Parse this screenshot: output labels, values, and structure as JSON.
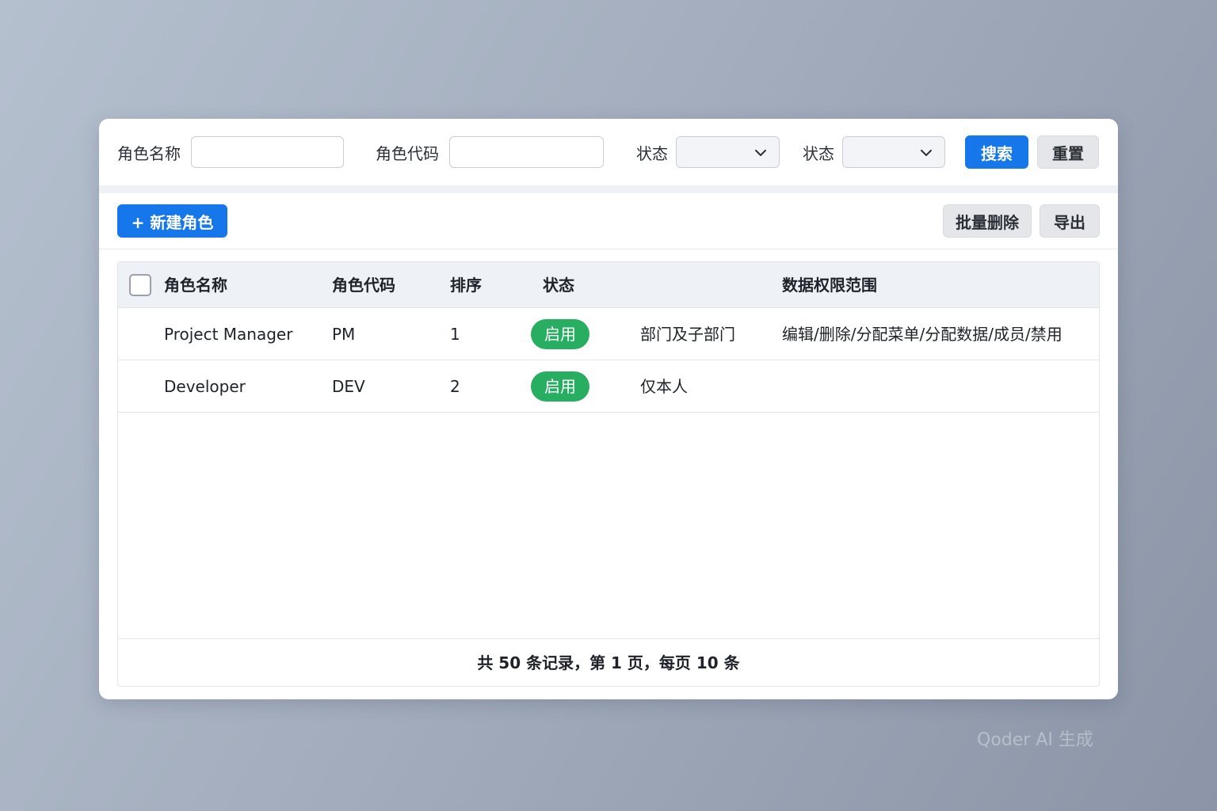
{
  "search": {
    "role_name_label": "角色名称",
    "role_name_value": "",
    "role_code_label": "角色代码",
    "role_code_value": "",
    "status1_label": "状态",
    "status1_value": "",
    "status2_label": "状态",
    "status2_value": "",
    "search_button": "搜索",
    "reset_button": "重置"
  },
  "toolbar": {
    "new_role_button": "+ 新建角色",
    "batch_delete_button": "批量删除",
    "export_button": "导出"
  },
  "table": {
    "columns": {
      "role_name": "角色名称",
      "role_code": "角色代码",
      "sort": "排序",
      "status": "状态",
      "data_scope": "数据权限范围"
    },
    "rows": [
      {
        "role_name": "Project Manager",
        "role_code": "PM",
        "sort": "1",
        "status": "启用",
        "scope": "部门及子部门",
        "permissions": "编辑/删除/分配菜单/分配数据/成员/禁用"
      },
      {
        "role_name": "Developer",
        "role_code": "DEV",
        "sort": "2",
        "status": "启用",
        "scope": "仅本人",
        "permissions": ""
      }
    ],
    "pagination_text": "共 50 条记录，第 1 页，每页 10 条"
  },
  "watermark": "Qoder AI 生成",
  "colors": {
    "primary": "#1677ea",
    "status_enabled": "#27ae60",
    "header_bg": "#eef1f5"
  },
  "icons": [
    "chevron-down-icon",
    "plus-icon",
    "checkbox"
  ]
}
